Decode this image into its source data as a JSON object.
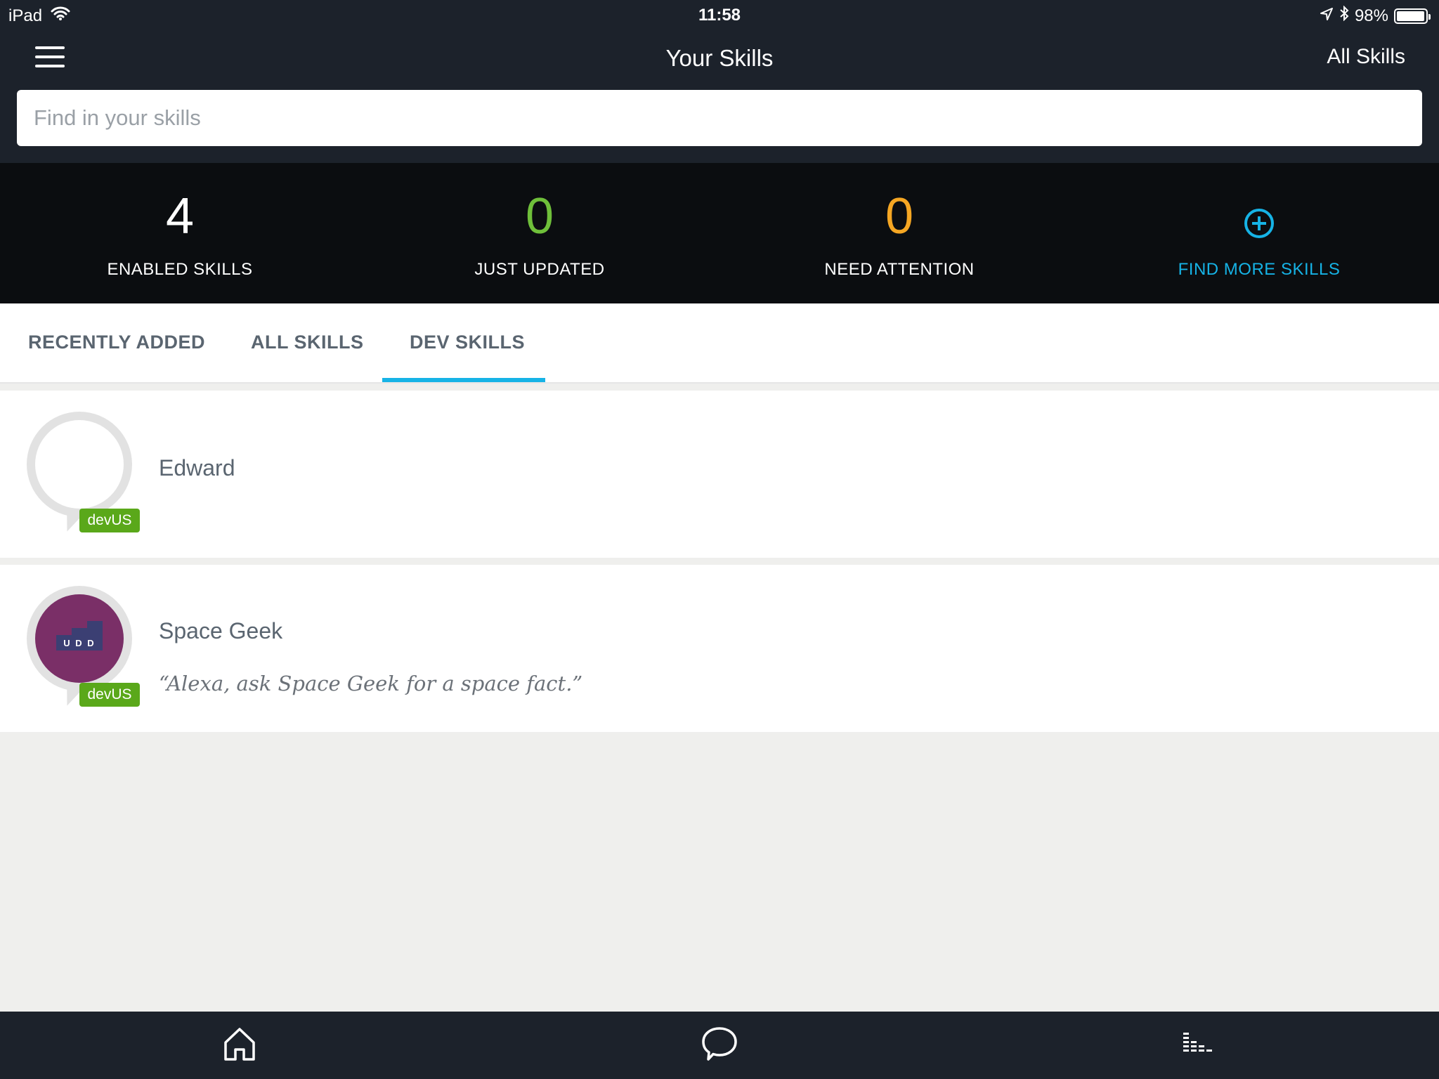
{
  "status_bar": {
    "device": "iPad",
    "time": "11:58",
    "battery": "98%",
    "battery_level": 0.98,
    "icons": [
      "wifi-icon",
      "location-arrow-icon",
      "bluetooth-icon",
      "battery-icon"
    ]
  },
  "header": {
    "title": "Your Skills",
    "right_link": "All Skills",
    "menu_icon": "hamburger-menu-icon"
  },
  "search": {
    "placeholder": "Find in your skills",
    "value": ""
  },
  "stats": [
    {
      "value": "4",
      "label": "ENABLED SKILLS",
      "color": "#ffffff"
    },
    {
      "value": "0",
      "label": "JUST UPDATED",
      "color": "#6fbf3a"
    },
    {
      "value": "0",
      "label": "NEED ATTENTION",
      "color": "#f5a623"
    },
    {
      "label": "FIND MORE SKILLS",
      "color": "#16b3e6",
      "icon": "plus-circle-icon"
    }
  ],
  "tabs": [
    {
      "label": "RECENTLY ADDED",
      "active": false
    },
    {
      "label": "ALL SKILLS",
      "active": false
    },
    {
      "label": "DEV SKILLS",
      "active": true
    }
  ],
  "accent_color": "#16b3e6",
  "skills": [
    {
      "name": "Edward",
      "badge": "devUS",
      "phrase": ""
    },
    {
      "name": "Space Geek",
      "badge": "devUS",
      "phrase": "“Alexa, ask Space Geek for a space fact.”",
      "logo_text": "U D D"
    }
  ],
  "bottom_nav": [
    "home-icon",
    "chat-bubble-icon",
    "now-playing-icon"
  ]
}
